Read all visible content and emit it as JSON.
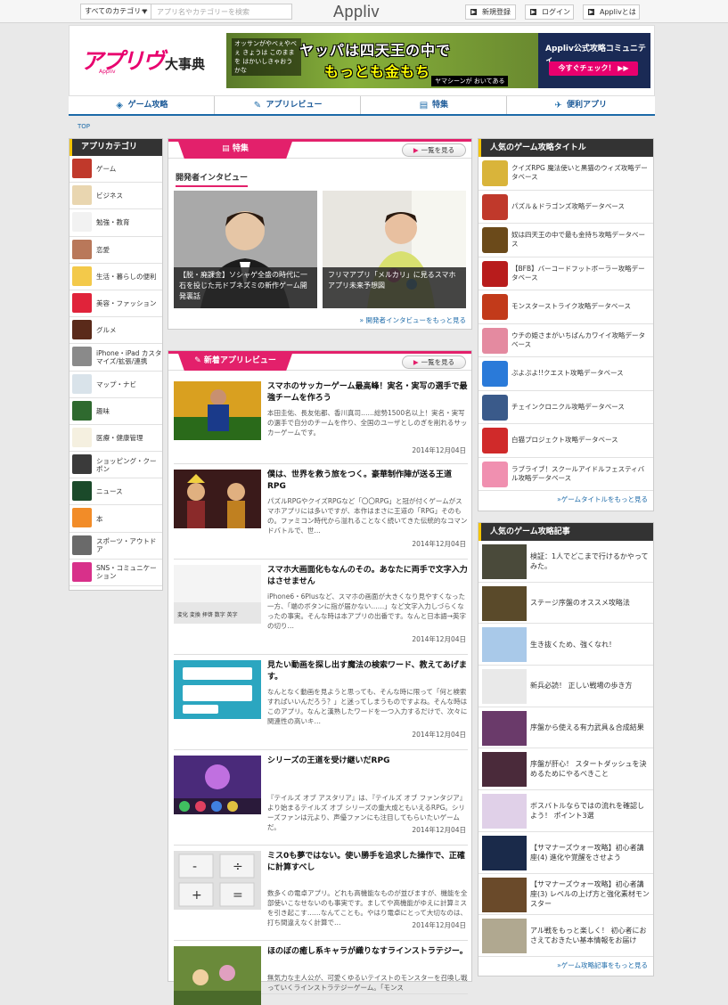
{
  "topbar": {
    "category_label": "すべてのカテゴリー",
    "search_placeholder": "アプリ名やカテゴリーを検索",
    "logo": "Appliv",
    "register_label": "新規登録",
    "login_label": "ログイン",
    "about_label": "Applivとは"
  },
  "header": {
    "brand_kana": "アプリヴ",
    "brand_kanji": "大事典",
    "brand_sub": "Appliv",
    "banner": {
      "small_text": "オッサンがやべぇやべぇ きょうは このままを はかいしきゃおうかな",
      "title1": "ヤッパは四天王の中で",
      "title2": "もっとも金もち",
      "bottom_text": "ヤマシーンが おいてある",
      "community_title": "Appliv公式攻略コミュニティ",
      "community_btn": "今すぐチェック！ ▶▶"
    }
  },
  "gnav": [
    "ゲーム攻略",
    "アプリレビュー",
    "特集",
    "便利アプリ"
  ],
  "breadcrumb": "TOP",
  "sidebar": {
    "title": "アプリカテゴリ",
    "items": [
      {
        "label": "ゲーム",
        "color": "#c0392b"
      },
      {
        "label": "ビジネス",
        "color": "#e9d6b0"
      },
      {
        "label": "勉強・教育",
        "color": "#f2f2f2"
      },
      {
        "label": "恋愛",
        "color": "#b9785a"
      },
      {
        "label": "生活・暮らしの便利",
        "color": "#f3c94a"
      },
      {
        "label": "美容・ファッション",
        "color": "#e0233a"
      },
      {
        "label": "グルメ",
        "color": "#5a2a1a"
      },
      {
        "label": "iPhone・iPad カスタマイズ/拡張/連携",
        "color": "#8a8a8a"
      },
      {
        "label": "マップ・ナビ",
        "color": "#d9e3ea"
      },
      {
        "label": "趣味",
        "color": "#2f6a2f"
      },
      {
        "label": "医療・健康管理",
        "color": "#f5f0e0"
      },
      {
        "label": "ショッピング・クーポン",
        "color": "#3a3a3a"
      },
      {
        "label": "ニュース",
        "color": "#1b4a2a"
      },
      {
        "label": "本",
        "color": "#f28c28"
      },
      {
        "label": "スポーツ・アウトドア",
        "color": "#6a6a6a"
      },
      {
        "label": "SNS・コミュニケーション",
        "color": "#d8308a"
      }
    ]
  },
  "feature": {
    "tab": "特集",
    "more": "一覧を見る",
    "heading": "開発者インタビュー",
    "items": [
      {
        "caption": "【脱・廃課金】ソシャゲ全盛の時代に一石を投じた元ドブネズミの新作ゲーム開発裏話"
      },
      {
        "caption": "フリマアプリ「メルカリ」に見るスマホアプリ未来予想図"
      }
    ],
    "more_link": "» 開発者インタビューをもっと見る"
  },
  "reviews": {
    "tab": "新着アプリレビュー",
    "more": "一覧を見る",
    "items": [
      {
        "title": "スマホのサッカーゲーム最高峰！実名・実写の選手で最強チームを作ろう",
        "desc": "本田圭佑、長友佑都、香川真司……総勢1500名以上！実名・実写の選手で自分のチームを作り、全国のユーザとしのぎを削れるサッカーゲームです。",
        "date": "2014年12月04日"
      },
      {
        "title": "僕は、世界を救う旅をつく。豪華制作陣が送る王道RPG",
        "desc": "パズルRPGやクイズRPGなど「〇〇RPG」と冠が付くゲームがスマホアプリには多いですが、本作はまさに王道の「RPG」そのもの。ファミコン時代から溢れることなく続いてきた伝統的なコマンドバトルで、世…",
        "date": "2014年12月04日"
      },
      {
        "title": "スマホ大画面化もなんのその。あなたに両手で文字入力はさせません",
        "desc": "iPhone6・6Plusなど、スマホの画面が大きくなり見やすくなった一方、「端のボタンに指が届かない……」など文字入力しづらくなったの事実。そんな時は本アプリの出番です。なんと日本語→英字の切り…",
        "date": "2014年12月04日"
      },
      {
        "title": "見たい動画を探し出す魔法の検索ワード、教えてあげます。",
        "desc": "なんとなく動画を見ようと思っても、そんな時に限って「何と検索すればいいんだろう？」と迷ってしまうものですよね。そんな時はこのアプリ。なんと漢熟したワードを一つ入力するだけで、次々に関連性の高いキ…",
        "date": "2014年12月04日"
      },
      {
        "title": "シリーズの王道を受け継いだRPG",
        "desc": "『テイルズ オブ アスタリア』は、『テイルズ オブ ファンタジア』より始まるテイルズ オブ シリーズの重大成ともいえるRPG。シリーズファンは元より、声優ファンにも注目してもらいたいゲームだ。",
        "date": "2014年12月04日"
      },
      {
        "title": "ミス0も夢ではない。使い勝手を追求した操作で、正確に計算すべし",
        "desc": "数多くの電卓アプリ。どれも高機能なものが並びますが、機能を全部使いこなせないのも事実です。ましてや高機能がゆえに計算ミスを引き起こす……なんてことも。やはり電卓にとって大切なのは、打ち間違えなく計算で…",
        "date": "2014年12月04日"
      },
      {
        "title": "ほのぼの癒し系キャラが織りなすラインストラテジー。",
        "desc": "無気力な主人公が、可愛くゆるいテイストのモンスターを召喚し戦っていくラインストラテジーゲーム。「モンス",
        "date": ""
      }
    ]
  },
  "popular_games": {
    "title": "人気のゲーム攻略タイトル",
    "items": [
      {
        "label": "クイズRPG 魔法使いと黒猫のウィズ攻略データベース",
        "color": "#d9b43a"
      },
      {
        "label": "パズル＆ドラゴンズ攻略データベース",
        "color": "#c0392b"
      },
      {
        "label": "奴は四天王の中で最も金持ち攻略データベース",
        "color": "#6b4a1a"
      },
      {
        "label": "【BFB】バーコードフットボーラー攻略データベース",
        "color": "#b81c1c"
      },
      {
        "label": "モンスターストライク攻略データベース",
        "color": "#c23a1a"
      },
      {
        "label": "ウチの姫さまがいちばんカワイイ攻略データベース",
        "color": "#e48aa0"
      },
      {
        "label": "ぷよぷよ!!クエスト攻略データベース",
        "color": "#2a7ad9"
      },
      {
        "label": "チェインクロニクル攻略データベース",
        "color": "#3a5a8a"
      },
      {
        "label": "白猫プロジェクト攻略データベース",
        "color": "#d02a2a"
      },
      {
        "label": "ラブライブ！スクールアイドルフェスティバル攻略データベース",
        "color": "#f090b0"
      }
    ],
    "more": "»ゲームタイトルをもっと見る"
  },
  "popular_articles": {
    "title": "人気のゲーム攻略記事",
    "items": [
      {
        "label": "検証：1人でどこまで行けるかやってみた。",
        "color": "#4a4a3a"
      },
      {
        "label": "ステージ序盤のオススメ攻略法",
        "color": "#5a4a2a"
      },
      {
        "label": "生き抜くため、強くなれ！",
        "color": "#a9c9e9"
      },
      {
        "label": "新兵必読！ 正しい戦場の歩き方",
        "color": "#e9e9e9"
      },
      {
        "label": "序盤から使える有力武具＆合成結果",
        "color": "#6a3a6a"
      },
      {
        "label": "序盤が肝心！ スタートダッシュを決めるためにやるべきこと",
        "color": "#4a2a3a"
      },
      {
        "label": "ボスバトルならではの流れを確認しよう！ ポイント3選",
        "color": "#e0d0e8"
      },
      {
        "label": "【サマナーズウォー攻略】初心者講座(4) 進化や覚醒をさせよう",
        "color": "#1a2a4a"
      },
      {
        "label": "【サマナーズウォー攻略】初心者講座(3) レベルの上げ方と強化素材モンスター",
        "color": "#6a4a2a"
      },
      {
        "label": "アル戦をもっと楽しく！ 初心者におさえておきたい基本情報をお届け",
        "color": "#b0a890"
      }
    ],
    "more": "»ゲーム攻略記事をもっと見る"
  }
}
